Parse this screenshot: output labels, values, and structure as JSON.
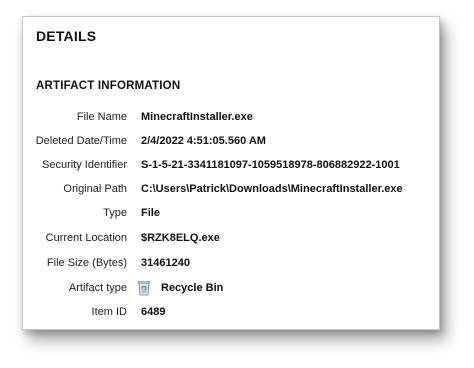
{
  "panel": {
    "title": "DETAILS",
    "section_title": "ARTIFACT INFORMATION"
  },
  "fields": [
    {
      "label": "File Name",
      "value": "MinecraftInstaller.exe"
    },
    {
      "label": "Deleted Date/Time",
      "value": "2/4/2022 4:51:05.560 AM"
    },
    {
      "label": "Security Identifier",
      "value": "S-1-5-21-3341181097-1059518978-806882922-1001"
    },
    {
      "label": "Original Path",
      "value": "C:\\Users\\Patrick\\Downloads\\MinecraftInstaller.exe"
    },
    {
      "label": "Type",
      "value": "File"
    },
    {
      "label": "Current Location",
      "value": "$RZK8ELQ.exe"
    },
    {
      "label": "File Size (Bytes)",
      "value": "31461240"
    },
    {
      "label": "Artifact type",
      "value": "Recycle Bin",
      "icon": "recycle-bin-icon"
    },
    {
      "label": "Item ID",
      "value": "6489"
    }
  ]
}
